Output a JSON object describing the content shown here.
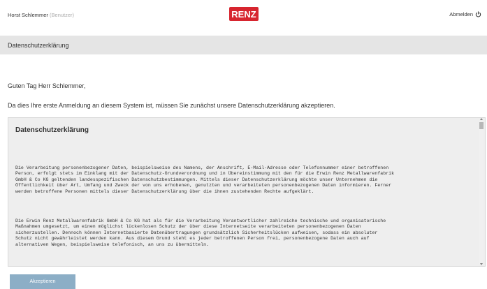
{
  "header": {
    "user_name": "Horst Schlemmer",
    "user_role": "(Benutzer)",
    "logo_text": "RENZ",
    "logout_label": "Abmelden",
    "brand_color": "#d7252f"
  },
  "page": {
    "title": "Datenschutzerklärung",
    "greeting": "Guten Tag Herr Schlemmer,",
    "intro": "Da dies Ihre erste Anmeldung an diesem System ist, müssen Sie zunächst unsere Datenschutzerklärung akzeptieren."
  },
  "policy": {
    "title": "Datenschutzerklärung",
    "paragraphs": [
      "Die Verarbeitung personenbezogener Daten, beispielsweise des Namens, der Anschrift, E-Mail-Adresse oder Telefonnummer einer betroffenen\nPerson, erfolgt stets im Einklang mit der Datenschutz-Grundverordnung und in Übereinstimmung mit den für die Erwin Renz Metallwarenfabrik\nGmbH & Co KG geltenden landesspezifischen Datenschutzbestimmungen. Mittels dieser Datenschutzerklärung möchte unser Unternehmen die\nÖffentlichkeit über Art, Umfang und Zweck der von uns erhobenen, genutzten und verarbeiteten personenbezogenen Daten informieren. Ferner\nwerden betroffene Personen mittels dieser Datenschutzerklärung über die ihnen zustehenden Rechte aufgeklärt.",
      "Die Erwin Renz Metallwarenfabrik GmbH & Co KG hat als für die Verarbeitung Verantwortlicher zahlreiche technische und organisatorische\nMaßnahmen umgesetzt, um einen möglichst lückenlosen Schutz der über diese Internetseite verarbeiteten personenbezogenen Daten\nsicherzustellen. Dennoch können Internetbasierte Datenübertragungen grundsätzlich Sicherheitslücken aufweisen, sodass ein absoluter\nSchutz nicht gewährleistet werden kann. Aus diesem Grund steht es jeder betroffenen Person frei, personenbezogene Daten auch auf\nalternativen Wegen, beispielsweise telefonisch, an uns zu übermitteln."
    ]
  },
  "actions": {
    "accept_label": "Akzeptieren",
    "accept_color": "#8caec6"
  }
}
